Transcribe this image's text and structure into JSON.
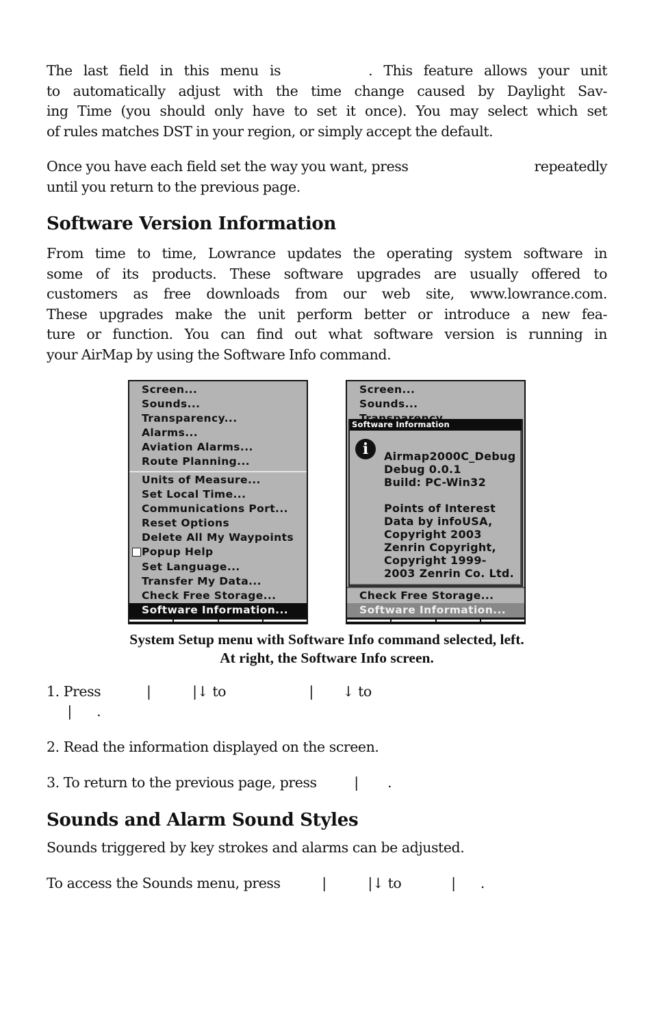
{
  "paragraphs": {
    "p1_lines": [
      {
        "before": "The last field in this menu is",
        "after": ". This feature allows your unit"
      },
      {
        "text": "to automatically adjust with the time change caused by Daylight Sav-"
      },
      {
        "text": "ing Time (you should only have to set it once). You may select which set"
      },
      {
        "text": "of rules matches DST in your region, or simply accept the default."
      }
    ],
    "p2_lines": [
      {
        "before": "Once you have each field set the way you want, press",
        "after": "repeatedly"
      },
      {
        "text": "until you return to the previous page."
      }
    ]
  },
  "sections": [
    {
      "heading": "Software Version Information",
      "body_lines": [
        "From time to time, Lowrance updates the operating system software in",
        "some of its products. These software upgrades are usually offered to",
        "customers as free downloads from our web site, www.lowrance.com.",
        "These upgrades make the unit perform better or introduce a new fea-",
        "ture or function. You can find out what software version is running in",
        "your AirMap by using the Software Info command."
      ]
    },
    {
      "heading": "Sounds and Alarm Sound Styles",
      "body_lines": [
        "Sounds triggered by key strokes and alarms can be adjusted."
      ]
    }
  ],
  "left_screen": {
    "menu_group_1": [
      "Screen...",
      "Sounds...",
      "Transparency...",
      "Alarms...",
      "Aviation Alarms...",
      "Route Planning..."
    ],
    "menu_group_2": [
      "Units of Measure...",
      "Set Local Time...",
      "Communications Port...",
      "Reset Options",
      "Delete All My Waypoints",
      "Popup Help",
      "Set Language...",
      "Transfer My Data...",
      "Check Free Storage...",
      "Software Information..."
    ],
    "popup_help_checked": false,
    "selected_item": "Software Information..."
  },
  "right_screen": {
    "menu_top": [
      "Screen...",
      "Sounds...",
      "Transparency..."
    ],
    "dialog_title": "Software Information",
    "dialog_icon": "info-icon",
    "dialog_lines": [
      "Airmap2000C_Debug",
      "Debug 0.0.1",
      "Build: PC-Win32",
      "",
      "Points of Interest",
      "Data by infoUSA,",
      "Copyright 2003",
      "Zenrin Copyright,",
      "Copyright 1999-",
      "2003 Zenrin Co. Ltd."
    ],
    "menu_bottom": [
      "Check Free Storage...",
      "Software Information..."
    ]
  },
  "caption": {
    "line1": "System Setup menu with Software Info command selected, left.",
    "line2": "At right, the Software Info screen."
  },
  "steps": {
    "step1_line1": "1. Press           |          |↓ to                    |       ↓ to",
    "step1_line2": "     |      .",
    "step2": "2. Read the information displayed on the screen.",
    "step3": "3. To return to the previous page, press         |       ."
  },
  "sounds_access": "To access the Sounds menu, press          |          |↓ to            |      ."
}
